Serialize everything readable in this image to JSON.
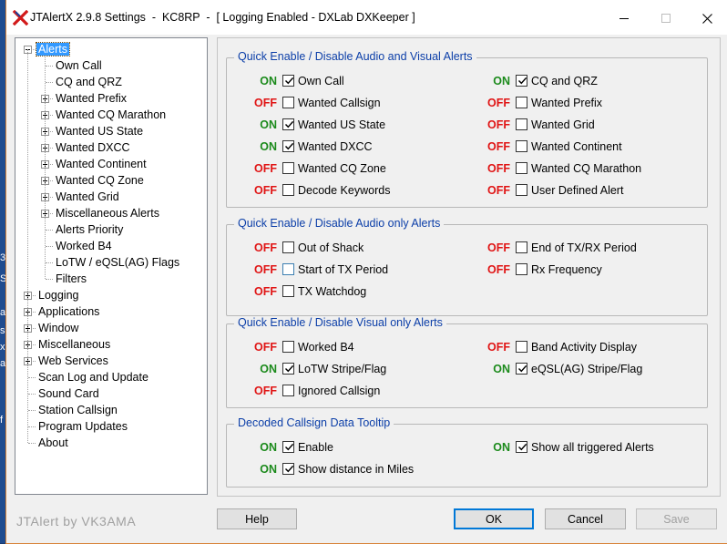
{
  "window": {
    "title": "JTAlertX 2.9.8 Settings  -  KC8RP  -  [ Logging Enabled - DXLab DXKeeper ]"
  },
  "titlebar_icons": {
    "minimize": "minimize-icon",
    "maximize": "maximize-icon",
    "close": "close-icon"
  },
  "tree": {
    "items": [
      {
        "label": "Alerts",
        "level": 0,
        "expander": "minus",
        "selected": true
      },
      {
        "label": "Own Call",
        "level": 1,
        "expander": "none"
      },
      {
        "label": "CQ and QRZ",
        "level": 1,
        "expander": "none"
      },
      {
        "label": "Wanted Prefix",
        "level": 1,
        "expander": "plus"
      },
      {
        "label": "Wanted CQ Marathon",
        "level": 1,
        "expander": "plus"
      },
      {
        "label": "Wanted US State",
        "level": 1,
        "expander": "plus"
      },
      {
        "label": "Wanted DXCC",
        "level": 1,
        "expander": "plus"
      },
      {
        "label": "Wanted Continent",
        "level": 1,
        "expander": "plus"
      },
      {
        "label": "Wanted CQ Zone",
        "level": 1,
        "expander": "plus"
      },
      {
        "label": "Wanted Grid",
        "level": 1,
        "expander": "plus"
      },
      {
        "label": "Miscellaneous Alerts",
        "level": 1,
        "expander": "plus"
      },
      {
        "label": "Alerts Priority",
        "level": 1,
        "expander": "none"
      },
      {
        "label": "Worked B4",
        "level": 1,
        "expander": "none"
      },
      {
        "label": "LoTW / eQSL(AG) Flags",
        "level": 1,
        "expander": "none"
      },
      {
        "label": "Filters",
        "level": 1,
        "expander": "none"
      },
      {
        "label": "Logging",
        "level": 0,
        "expander": "plus"
      },
      {
        "label": "Applications",
        "level": 0,
        "expander": "plus"
      },
      {
        "label": "Window",
        "level": 0,
        "expander": "plus"
      },
      {
        "label": "Miscellaneous",
        "level": 0,
        "expander": "plus"
      },
      {
        "label": "Web Services",
        "level": 0,
        "expander": "plus"
      },
      {
        "label": "Scan Log and Update",
        "level": 0,
        "expander": "none"
      },
      {
        "label": "Sound Card",
        "level": 0,
        "expander": "none"
      },
      {
        "label": "Station Callsign",
        "level": 0,
        "expander": "none"
      },
      {
        "label": "Program Updates",
        "level": 0,
        "expander": "none"
      },
      {
        "label": "About",
        "level": 0,
        "expander": "none"
      }
    ]
  },
  "groups": [
    {
      "title": "Quick Enable / Disable Audio and Visual Alerts",
      "left": [
        {
          "state": "ON",
          "label": "Own Call",
          "checked": true
        },
        {
          "state": "OFF",
          "label": "Wanted Callsign",
          "checked": false
        },
        {
          "state": "ON",
          "label": "Wanted US State",
          "checked": true
        },
        {
          "state": "ON",
          "label": "Wanted DXCC",
          "checked": true
        },
        {
          "state": "OFF",
          "label": "Wanted CQ Zone",
          "checked": false
        },
        {
          "state": "OFF",
          "label": "Decode Keywords",
          "checked": false
        }
      ],
      "right": [
        {
          "state": "ON",
          "label": "CQ and QRZ",
          "checked": true
        },
        {
          "state": "OFF",
          "label": "Wanted Prefix",
          "checked": false
        },
        {
          "state": "OFF",
          "label": "Wanted Grid",
          "checked": false
        },
        {
          "state": "OFF",
          "label": "Wanted Continent",
          "checked": false
        },
        {
          "state": "OFF",
          "label": "Wanted CQ Marathon",
          "checked": false
        },
        {
          "state": "OFF",
          "label": "User Defined Alert",
          "checked": false
        }
      ]
    },
    {
      "title": "Quick Enable / Disable Audio only Alerts",
      "left": [
        {
          "state": "OFF",
          "label": "Out of Shack",
          "checked": false
        },
        {
          "state": "OFF",
          "label": "Start of TX Period",
          "checked": false,
          "highlight": true
        },
        {
          "state": "OFF",
          "label": "TX Watchdog",
          "checked": false
        }
      ],
      "right": [
        {
          "state": "OFF",
          "label": "End of TX/RX Period",
          "checked": false
        },
        {
          "state": "OFF",
          "label": "Rx Frequency",
          "checked": false
        }
      ]
    },
    {
      "title": "Quick Enable / Disable Visual only Alerts",
      "left": [
        {
          "state": "OFF",
          "label": "Worked B4",
          "checked": false
        },
        {
          "state": "ON",
          "label": "LoTW Stripe/Flag",
          "checked": true
        },
        {
          "state": "OFF",
          "label": "Ignored Callsign",
          "checked": false
        }
      ],
      "right": [
        {
          "state": "OFF",
          "label": "Band Activity Display",
          "checked": false
        },
        {
          "state": "ON",
          "label": "eQSL(AG) Stripe/Flag",
          "checked": true
        }
      ]
    },
    {
      "title": "Decoded Callsign Data Tooltip",
      "left": [
        {
          "state": "ON",
          "label": "Enable",
          "checked": true
        },
        {
          "state": "ON",
          "label": "Show distance in Miles",
          "checked": true
        }
      ],
      "right": [
        {
          "state": "ON",
          "label": "Show all triggered Alerts",
          "checked": true
        }
      ]
    }
  ],
  "footer": {
    "brand": "JTAlert by VK3AMA"
  },
  "buttons": {
    "help": "Help",
    "ok": "OK",
    "cancel": "Cancel",
    "save": "Save"
  },
  "colors": {
    "on": "#1b8a1b",
    "off": "#e01414",
    "group_title": "#0b3ea8",
    "selection": "#3399ff"
  },
  "desktop_edge": [
    "3",
    "S",
    "a",
    "s",
    "x",
    "a",
    "f"
  ]
}
